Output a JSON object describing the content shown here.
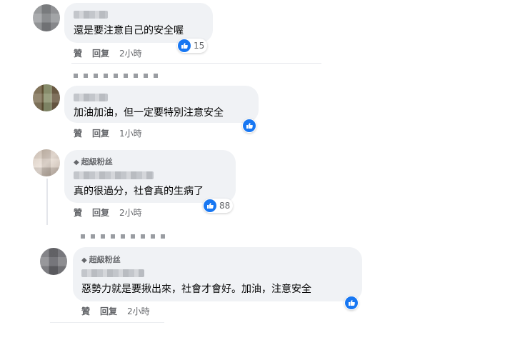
{
  "actions": {
    "like": "贊",
    "reply": "回复"
  },
  "comments": [
    {
      "badge": "",
      "text": "還是要注意自己的安全喔",
      "time": "2小時",
      "reactions": "15"
    },
    {
      "badge": "",
      "text": "加油加油，但一定要特別注意安全",
      "time": "1小時",
      "reactions": ""
    },
    {
      "badge": "超級粉丝",
      "text": "真的很過分，社會真的生病了",
      "time": "2小時",
      "reactions": "88"
    },
    {
      "badge": "超級粉丝",
      "text": "惡勢力就是要揪出來，社會才會好。加油，注意安全",
      "time": "2小時",
      "reactions": ""
    }
  ],
  "icons": {
    "like": "thumbs-up-icon",
    "badge": "diamond-icon"
  },
  "colors": {
    "like_blue": "#1877f2",
    "bubble": "#f0f2f5",
    "meta": "#65676b"
  }
}
